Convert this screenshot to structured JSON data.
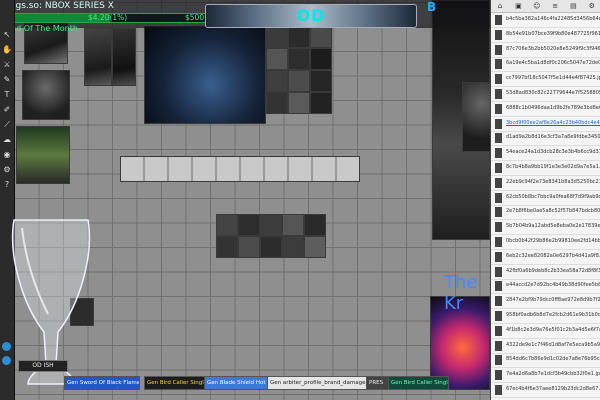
{
  "header": {
    "title": "Tags.so: NBOX SERIES X",
    "subtitle": "End Of The Month",
    "price": "$4.20(1%)",
    "money": "$500",
    "logo_text": "OD",
    "right_tag": "B",
    "progress": 0.46
  },
  "canvas": {
    "banner_text": "The Kr",
    "od_button": "OD     ISH"
  },
  "right_panel": {
    "files": [
      "b4c5ba382a146c4fa22485d3456b64c4.jpg",
      "8b54e91b07bce39f9b80e487725f9618.jpg",
      "87c706e3b2bb5020e8e5249f9c3f9467.jpg",
      "6a19e4c5ba1d8df0c206c5047e72de08.jpg",
      "cc7997bf18c5047f5e1d44e4f87425.jpg",
      "53d8ad830c82c22779644e7f5258805.jpg",
      "6888c1b0496daa1d9b2fe789e3bd8e6d.jpg",
      "3bcd9f00ee2af8e26a4c23b40bdc4e48.jpg",
      "d1ad9a2b8d16e3cf3a7a8e9fdbe3450.jpg",
      "54eace24a1d3dcb28c3e3b4b6cc9d37.jpg",
      "8c7b4b8a9bb19f1e3e3e02d9a7e5a1.jpg",
      "22eb9c94f2e73e8341b8a3d5250bc21c.jpg",
      "62cb50b8bc7bbc9a0fea68f7d9f9ab9d.jpg",
      "2e7b8f6be0ae5a8c52f57b847bdcb80.jpg",
      "5b7b04b9a12abd5e8eba0e2e17839e6e.jpg",
      "0bcb0b42f29b86e2b99810ee2fd14bb5.jpg",
      "6eb2c32ee82082a0e6297b4d41a9f8.jpg",
      "42fbf0a6b9deb8c2b33ea58a72d8f8f3.jpg",
      "e44accd2e7d92bc4b49b38d90fee5b87.jpg",
      "2847e2bf9b79dcc0ff8ae972e8d9b7f2.jpg",
      "958bf0adb6b8d7e2fcb2d61e9b31b0d.jpg",
      "4f1b8c2e3d9a76e5f01c2b3a4d5e6f7a.jpg",
      "4322de9e1c7f46d1d8af7e5eca9b5a9.jpg",
      "854dd6c7b86e9d1c02de7a8e76b95cc.jpg",
      "7e4a2d6a8b7e1dcf3b49cbb32f0e1.jpg",
      "67ec4b4f6e37aee8129b23dc2d8e67.jpg"
    ],
    "selected_index": 7
  },
  "bottom_bar": {
    "buttons": [
      "Gen Sword Of Black Flame Gifts",
      "Gen Bird Caller Single Item",
      "Gen Blade Shield Hot Coilt",
      "Gen arbiter_profile_brand_damage_range_single",
      "PRES",
      "Gen Bird Caller Single Item"
    ]
  },
  "colors": {
    "accent_green": "#3ef07a",
    "logo_teal": "#00e7e7",
    "link_blue": "#1a66d8",
    "banner_blue": "#3d8bff"
  }
}
